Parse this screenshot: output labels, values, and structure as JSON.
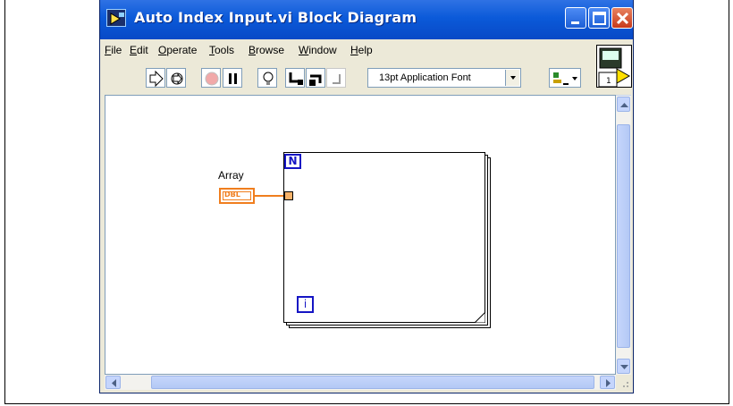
{
  "window": {
    "title": "Auto Index Input.vi Block Diagram"
  },
  "menu": {
    "items": [
      "File",
      "Edit",
      "Operate",
      "Tools",
      "Browse",
      "Window",
      "Help"
    ],
    "underline": [
      "F",
      "E",
      "O",
      "T",
      "B",
      "W",
      "H"
    ]
  },
  "toolbar": {
    "font": "13pt Application Font",
    "tools": [
      "run-arrow-icon",
      "run-continuous-icon",
      "abort-icon",
      "pause-icon",
      "highlight-execution-icon",
      "step-into-icon",
      "step-over-icon",
      "step-out-icon"
    ],
    "context_help_number": "1"
  },
  "diagram": {
    "control_label": "Array",
    "control_type": "DBL",
    "loop_count_terminal": "N",
    "loop_iteration_terminal": "i"
  },
  "colors": {
    "titlebar": "#0b5ad9",
    "window_bg": "#ece9d8",
    "dbl_orange": "#f07e1e",
    "loop_terminal_blue": "#1515c4"
  }
}
